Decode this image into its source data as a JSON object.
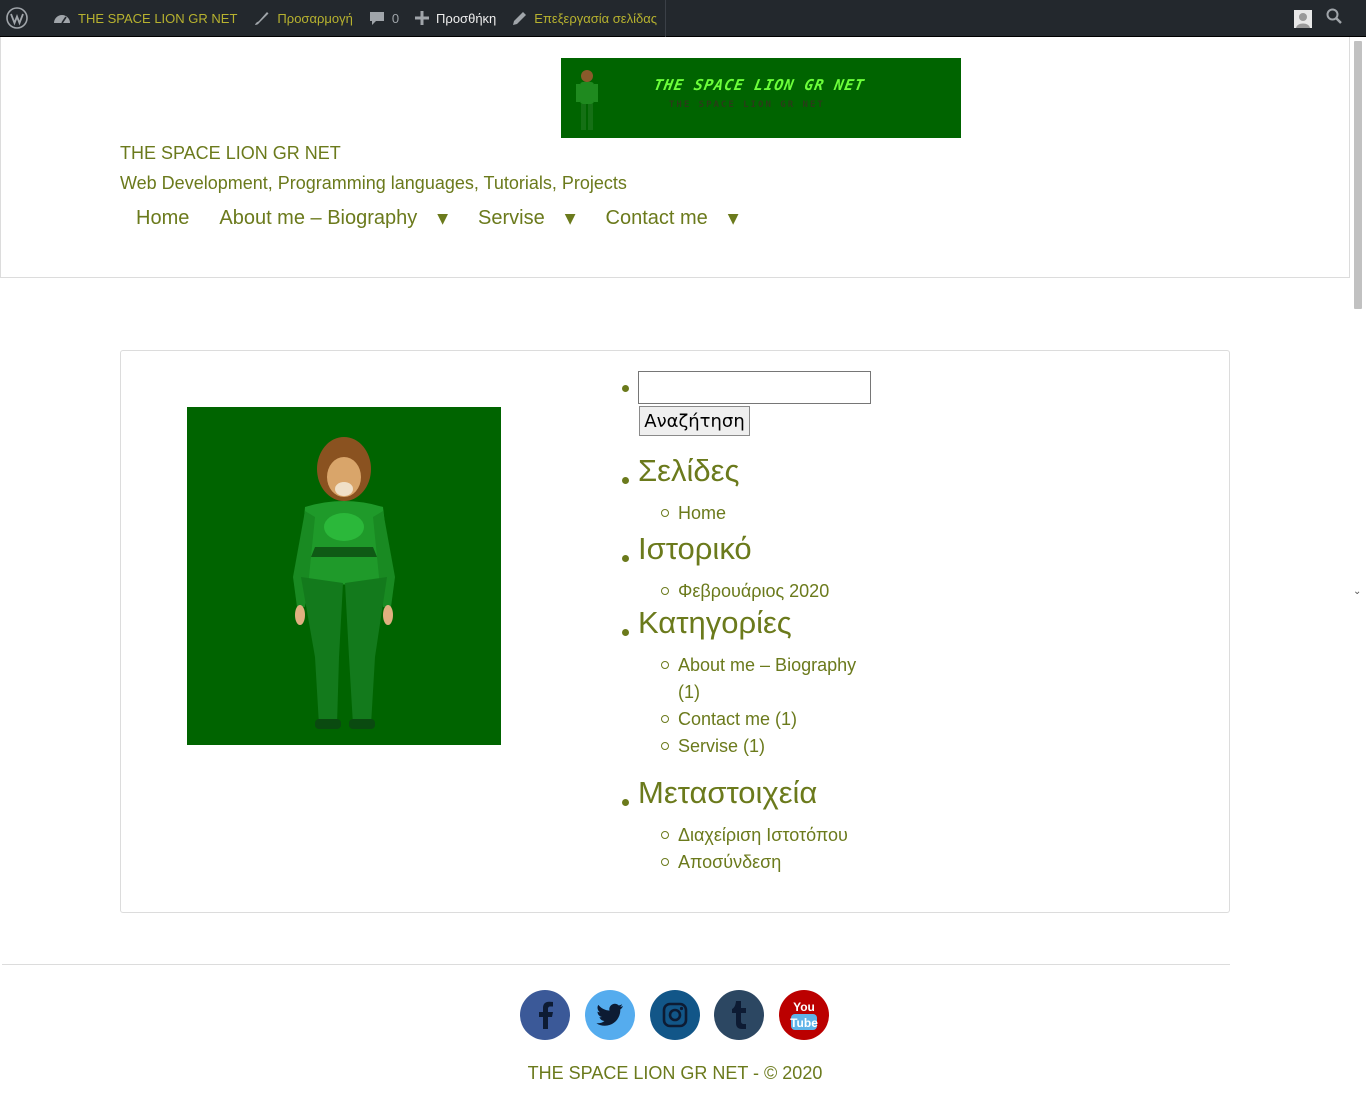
{
  "admin_bar": {
    "site_name": "THE SPACE LION GR NET",
    "customize": "Προσαρμογή",
    "comments_count": "0",
    "add_new": "Προσθήκη",
    "edit_page": "Επεξεργασία σελίδας"
  },
  "header": {
    "banner_text": "THE SPACE LION GR NET",
    "site_title": "THE SPACE LION GR NET",
    "site_description": "Web Development, Programming languages, Tutorials, Projects",
    "nav": [
      {
        "label": "Home",
        "has_submenu": false
      },
      {
        "label": "About me – Biography",
        "has_submenu": true
      },
      {
        "label": "Servise",
        "has_submenu": true
      },
      {
        "label": "Contact me",
        "has_submenu": true
      }
    ]
  },
  "sidebar": {
    "search_value": "",
    "search_button": "Αναζήτηση",
    "pages_title": "Σελίδες",
    "pages": [
      "Home"
    ],
    "archives_title": "Ιστορικό",
    "archives": [
      "Φεβρουάριος 2020"
    ],
    "categories_title": "Κατηγορίες",
    "categories": [
      "About me – Biography",
      "(1)",
      "Contact me (1)",
      "Servise (1)"
    ],
    "meta_title": "Μεταστοιχεία",
    "meta": [
      "Διαχείριση Ιστοτόπου",
      "Αποσύνδεση"
    ]
  },
  "footer": {
    "social": [
      {
        "name": "facebook",
        "color": "#3b5998"
      },
      {
        "name": "twitter",
        "color": "#55acee"
      },
      {
        "name": "instagram",
        "color": "#125688"
      },
      {
        "name": "tumblr",
        "color": "#2c4762"
      },
      {
        "name": "youtube",
        "color": "#bb0000"
      }
    ],
    "copyright": "THE SPACE LION GR NET - © 2020"
  },
  "colors": {
    "accent": "#6b7a1c",
    "admin_bar_bg": "#23282d",
    "image_bg": "#006400"
  }
}
